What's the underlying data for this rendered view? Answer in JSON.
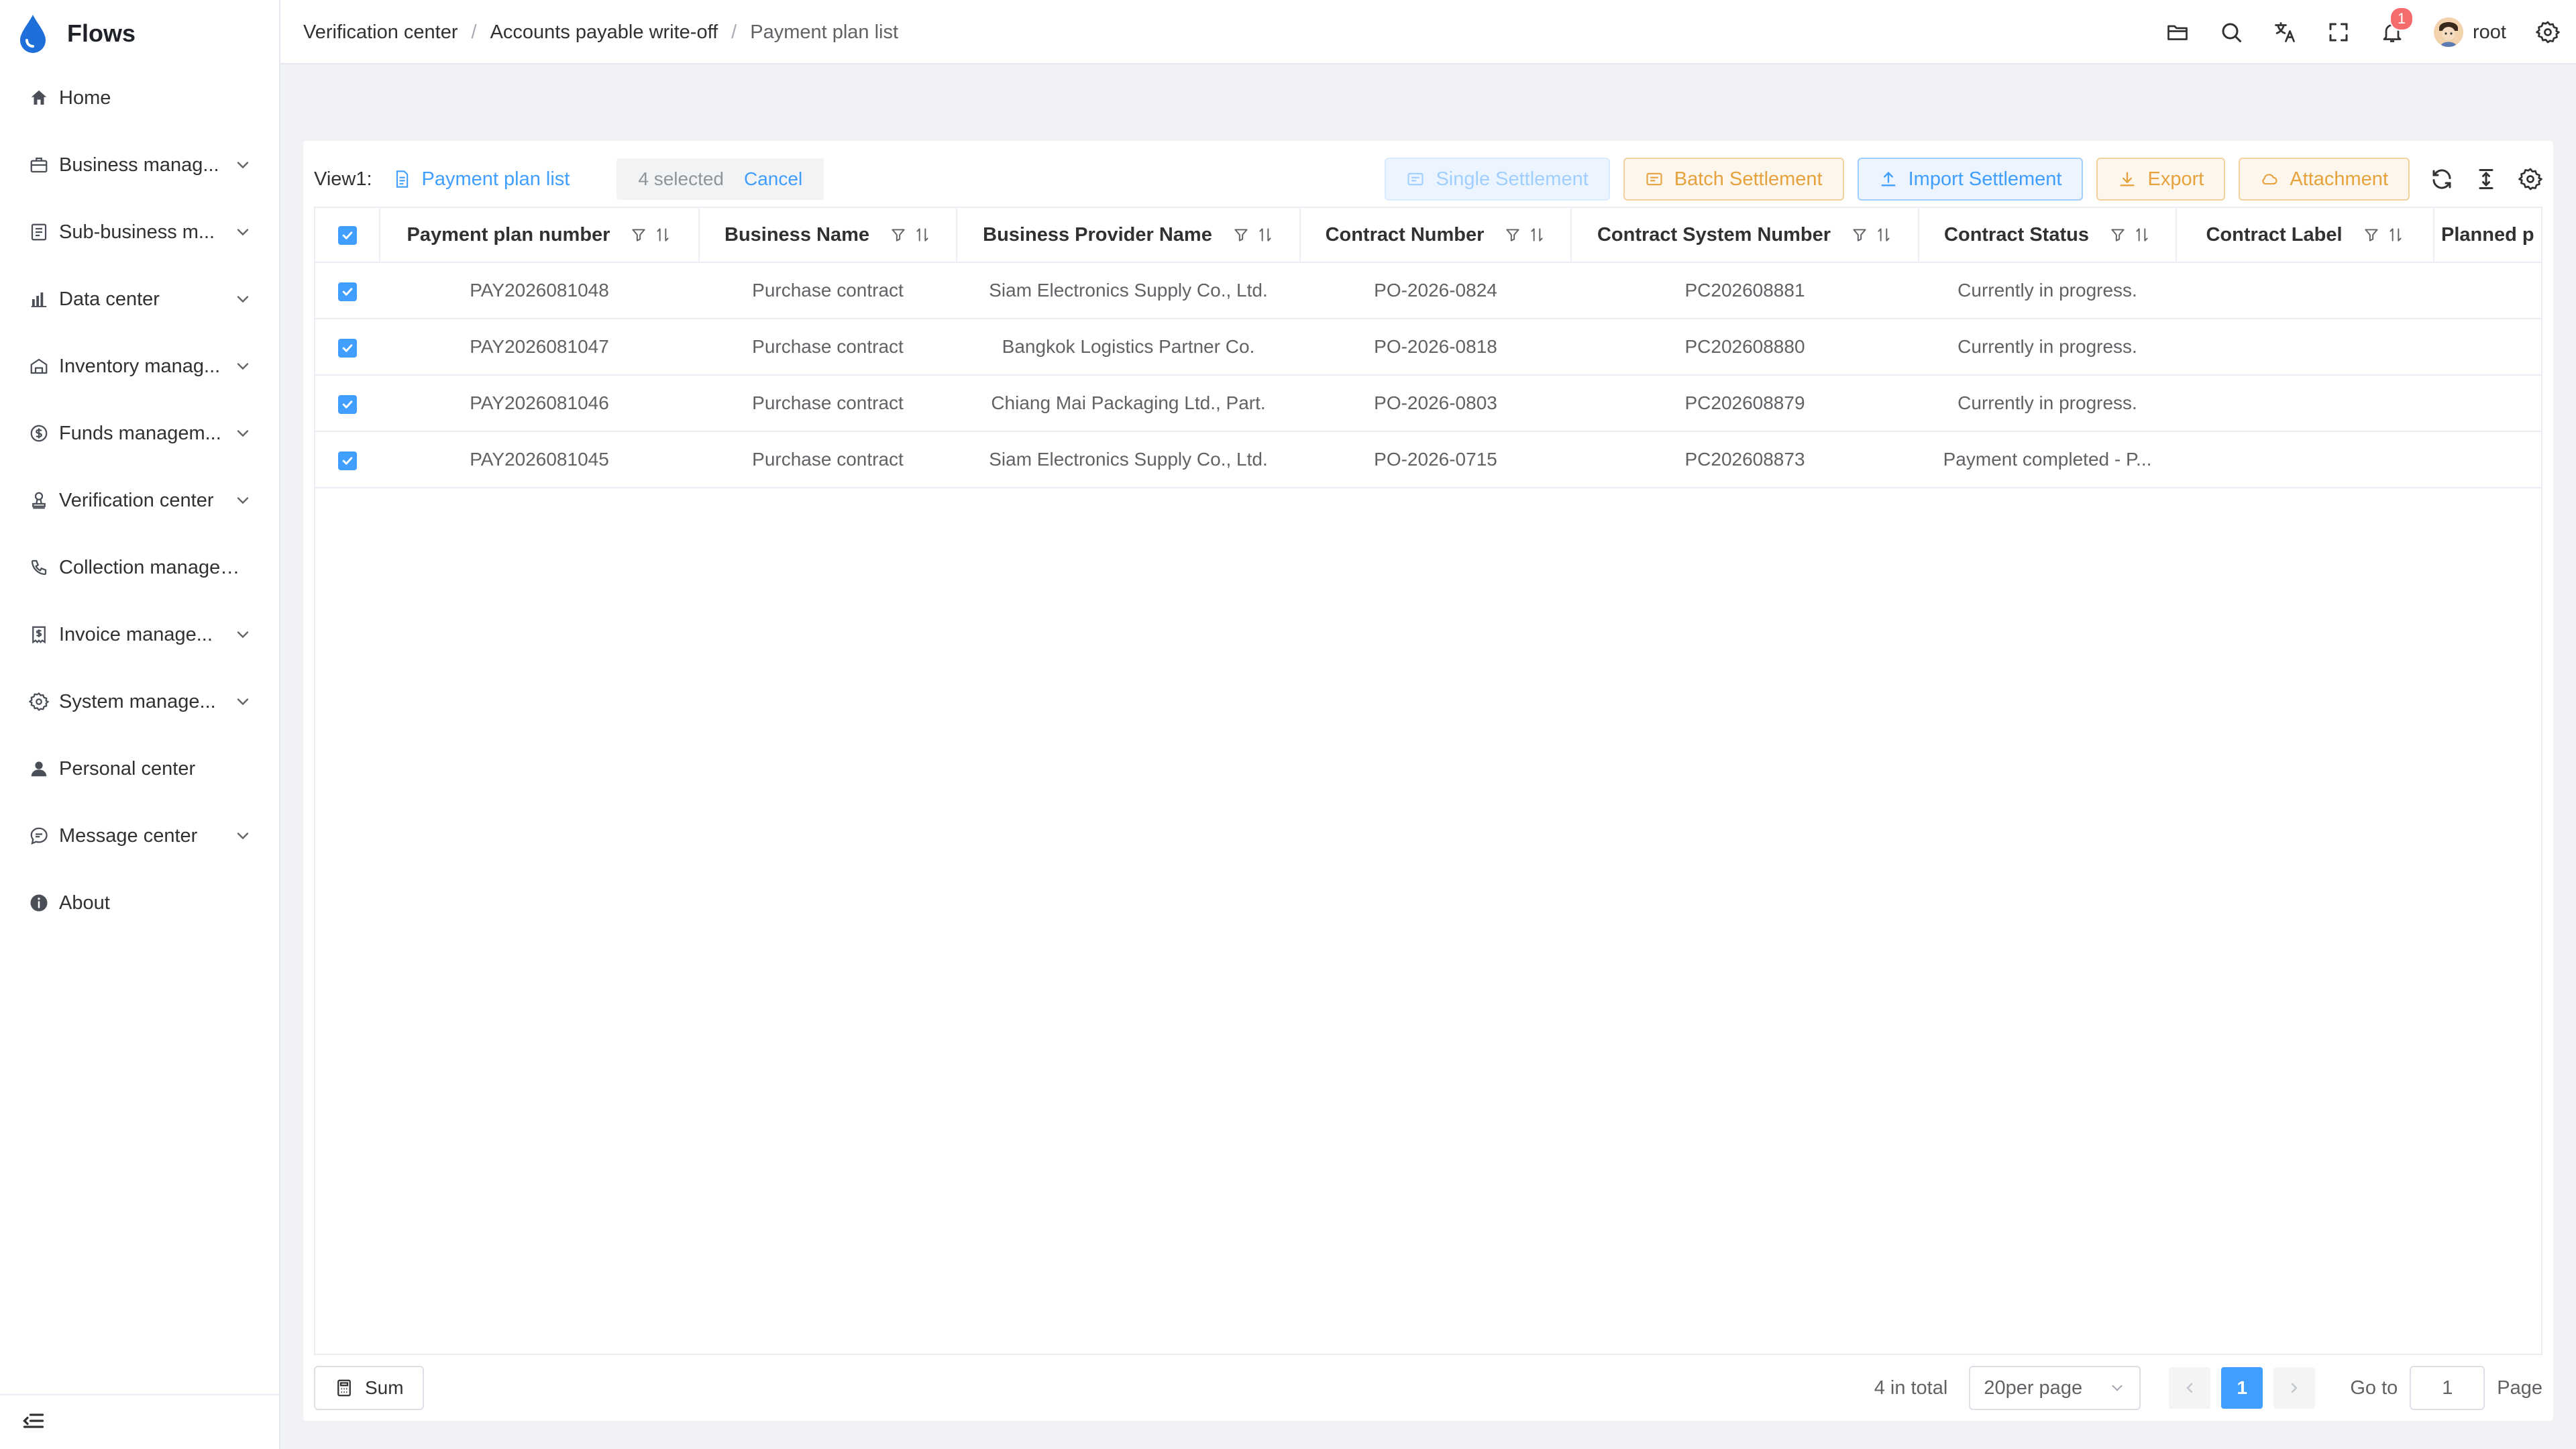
{
  "app": {
    "name": "Flows"
  },
  "sidebar": {
    "items": [
      {
        "label": "Home",
        "icon": "home-icon",
        "expandable": false
      },
      {
        "label": "Business manag...",
        "icon": "briefcase-icon",
        "expandable": true
      },
      {
        "label": "Sub-business m...",
        "icon": "document-list-icon",
        "expandable": true
      },
      {
        "label": "Data center",
        "icon": "bar-chart-icon",
        "expandable": true
      },
      {
        "label": "Inventory manag...",
        "icon": "warehouse-icon",
        "expandable": true
      },
      {
        "label": "Funds managem...",
        "icon": "coin-icon",
        "expandable": true
      },
      {
        "label": "Verification center",
        "icon": "stamp-icon",
        "expandable": true
      },
      {
        "label": "Collection managem...",
        "icon": "phone-icon",
        "expandable": false
      },
      {
        "label": "Invoice manage...",
        "icon": "invoice-icon",
        "expandable": true
      },
      {
        "label": "System manage...",
        "icon": "gear-icon",
        "expandable": true
      },
      {
        "label": "Personal center",
        "icon": "user-icon",
        "expandable": false
      },
      {
        "label": "Message center",
        "icon": "chat-icon",
        "expandable": true
      },
      {
        "label": "About",
        "icon": "info-icon",
        "expandable": false
      }
    ]
  },
  "header": {
    "breadcrumb": [
      "Verification center",
      "Accounts payable write-off",
      "Payment plan list"
    ],
    "notification_count": "1",
    "user": "root"
  },
  "toolbar": {
    "view_label": "View1:",
    "view_name": "Payment plan list",
    "selected_text": "4 selected",
    "cancel": "Cancel",
    "buttons": {
      "single_settlement": "Single Settlement",
      "batch_settlement": "Batch Settlement",
      "import_settlement": "Import Settlement",
      "export": "Export",
      "attachment": "Attachment"
    }
  },
  "table": {
    "columns": [
      "Payment plan number",
      "Business Name",
      "Business Provider Name",
      "Contract Number",
      "Contract System Number",
      "Contract Status",
      "Contract Label",
      "Planned p"
    ],
    "rows": [
      {
        "selected": true,
        "cells": [
          "PAY2026081048",
          "Purchase contract",
          "Siam Electronics Supply Co., Ltd.",
          "PO-2026-0824",
          "PC202608881",
          "Currently in progress.",
          "",
          ""
        ]
      },
      {
        "selected": true,
        "cells": [
          "PAY2026081047",
          "Purchase contract",
          "Bangkok Logistics Partner Co.",
          "PO-2026-0818",
          "PC202608880",
          "Currently in progress.",
          "",
          ""
        ]
      },
      {
        "selected": true,
        "cells": [
          "PAY2026081046",
          "Purchase contract",
          "Chiang Mai Packaging Ltd., Part.",
          "PO-2026-0803",
          "PC202608879",
          "Currently in progress.",
          "",
          ""
        ]
      },
      {
        "selected": true,
        "cells": [
          "PAY2026081045",
          "Purchase contract",
          "Siam Electronics Supply Co., Ltd.",
          "PO-2026-0715",
          "PC202608873",
          "Payment completed - P...",
          "",
          ""
        ]
      }
    ]
  },
  "footer": {
    "sum": "Sum",
    "total": "4 in total",
    "page_size": "20per page",
    "current_page": "1",
    "goto_label": "Go to",
    "goto_value": "1",
    "page_label": "Page"
  },
  "colors": {
    "accent": "#409eff",
    "warning": "#e6a23c",
    "badge": "#f56c6c"
  }
}
